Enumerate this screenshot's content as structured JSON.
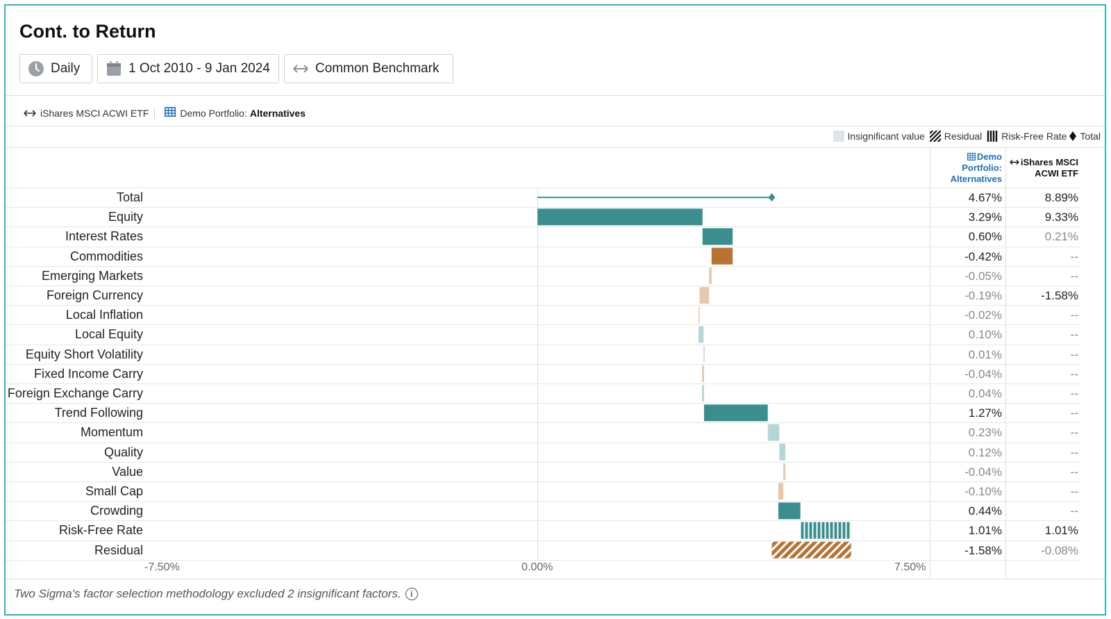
{
  "title": "Cont. to Return",
  "toolbar": {
    "frequency_label": "Daily",
    "date_range_label": "1 Oct 2010 - 9 Jan 2024",
    "benchmark_label": "Common Benchmark"
  },
  "selection": {
    "benchmark": "iShares MSCI ACWI ETF",
    "portfolio_prefix": "Demo Portfolio:",
    "portfolio_name": "Alternatives"
  },
  "key": {
    "insignificant": "Insignificant value",
    "residual": "Residual",
    "risk_free": "Risk-Free Rate",
    "total": "Total"
  },
  "columns": {
    "portfolio_header": "Demo Portfolio: Alternatives",
    "benchmark_header": "iShares MSCI ACWI ETF"
  },
  "colors": {
    "significant_positive": "#3a8f8e",
    "significant_negative": "#b87333",
    "insignificant_positive": "#b5d6d6",
    "insignificant_negative": "#e8c7ab",
    "link_blue": "#1f6fb8",
    "frame": "#2bb5be"
  },
  "chart_data": {
    "type": "waterfall",
    "x_axis": {
      "ticks": [
        "-7.50%",
        "0.00%",
        "7.50%"
      ],
      "range": [
        -7.5,
        7.5
      ],
      "unit": "%"
    },
    "rows": [
      {
        "label": "Total",
        "value": 4.67,
        "portfolio_display": "4.67%",
        "benchmark_display": "8.89%",
        "kind": "total",
        "significant": true,
        "benchmark_significant": true
      },
      {
        "label": "Equity",
        "value": 3.29,
        "portfolio_display": "3.29%",
        "benchmark_display": "9.33%",
        "kind": "factor",
        "significant": true,
        "benchmark_significant": true
      },
      {
        "label": "Interest Rates",
        "value": 0.6,
        "portfolio_display": "0.60%",
        "benchmark_display": "0.21%",
        "kind": "factor",
        "significant": true,
        "benchmark_significant": false
      },
      {
        "label": "Commodities",
        "value": -0.42,
        "portfolio_display": "-0.42%",
        "benchmark_display": "--",
        "kind": "factor",
        "significant": true,
        "benchmark_significant": false
      },
      {
        "label": "Emerging Markets",
        "value": -0.05,
        "portfolio_display": "-0.05%",
        "benchmark_display": "--",
        "kind": "factor",
        "significant": false,
        "benchmark_significant": false
      },
      {
        "label": "Foreign Currency",
        "value": -0.19,
        "portfolio_display": "-0.19%",
        "benchmark_display": "-1.58%",
        "kind": "factor",
        "significant": false,
        "benchmark_significant": true
      },
      {
        "label": "Local Inflation",
        "value": -0.02,
        "portfolio_display": "-0.02%",
        "benchmark_display": "--",
        "kind": "factor",
        "significant": false,
        "benchmark_significant": false
      },
      {
        "label": "Local Equity",
        "value": 0.1,
        "portfolio_display": "0.10%",
        "benchmark_display": "--",
        "kind": "factor",
        "significant": false,
        "benchmark_significant": false
      },
      {
        "label": "Equity Short Volatility",
        "value": 0.01,
        "portfolio_display": "0.01%",
        "benchmark_display": "--",
        "kind": "factor",
        "significant": false,
        "benchmark_significant": false
      },
      {
        "label": "Fixed Income Carry",
        "value": -0.04,
        "portfolio_display": "-0.04%",
        "benchmark_display": "--",
        "kind": "factor",
        "significant": false,
        "benchmark_significant": false
      },
      {
        "label": "Foreign Exchange Carry",
        "value": 0.04,
        "portfolio_display": "0.04%",
        "benchmark_display": "--",
        "kind": "factor",
        "significant": false,
        "benchmark_significant": false
      },
      {
        "label": "Trend Following",
        "value": 1.27,
        "portfolio_display": "1.27%",
        "benchmark_display": "--",
        "kind": "factor",
        "significant": true,
        "benchmark_significant": false
      },
      {
        "label": "Momentum",
        "value": 0.23,
        "portfolio_display": "0.23%",
        "benchmark_display": "--",
        "kind": "factor",
        "significant": false,
        "benchmark_significant": false
      },
      {
        "label": "Quality",
        "value": 0.12,
        "portfolio_display": "0.12%",
        "benchmark_display": "--",
        "kind": "factor",
        "significant": false,
        "benchmark_significant": false
      },
      {
        "label": "Value",
        "value": -0.04,
        "portfolio_display": "-0.04%",
        "benchmark_display": "--",
        "kind": "factor",
        "significant": false,
        "benchmark_significant": false
      },
      {
        "label": "Small Cap",
        "value": -0.1,
        "portfolio_display": "-0.10%",
        "benchmark_display": "--",
        "kind": "factor",
        "significant": false,
        "benchmark_significant": false
      },
      {
        "label": "Crowding",
        "value": 0.44,
        "portfolio_display": "0.44%",
        "benchmark_display": "--",
        "kind": "factor",
        "significant": true,
        "benchmark_significant": false
      },
      {
        "label": "Risk-Free Rate",
        "value": 1.01,
        "portfolio_display": "1.01%",
        "benchmark_display": "1.01%",
        "kind": "riskfree",
        "significant": true,
        "benchmark_significant": true
      },
      {
        "label": "Residual",
        "value": -1.58,
        "portfolio_display": "-1.58%",
        "benchmark_display": "-0.08%",
        "kind": "residual",
        "significant": true,
        "benchmark_significant": false
      }
    ]
  },
  "footer": {
    "note": "Two Sigma's factor selection methodology excluded 2 insignificant factors."
  }
}
